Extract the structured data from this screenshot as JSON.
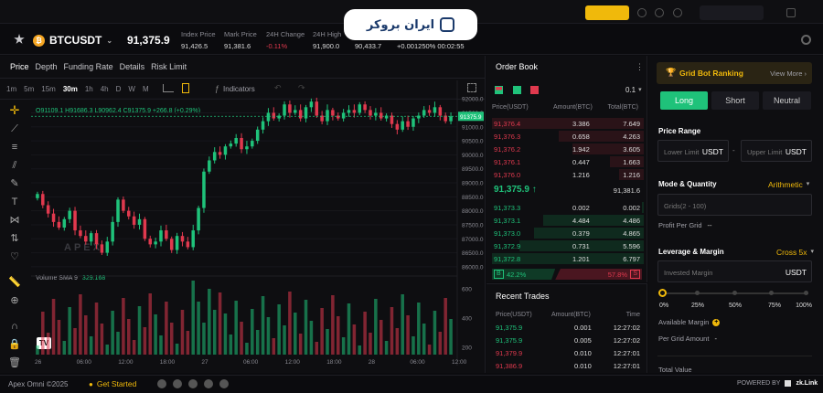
{
  "watermark": {
    "text": "ایران بروکر"
  },
  "ticker": {
    "symbol": "BTCUSDT",
    "last": "91,375.9",
    "stats": [
      {
        "label": "Index Price",
        "value": "91,426.5"
      },
      {
        "label": "Mark Price",
        "value": "91,381.6"
      },
      {
        "label": "24H Change",
        "value": "-0.11%"
      },
      {
        "label": "24H High",
        "value": "91,900.0"
      },
      {
        "label": "",
        "value": "90,433.7"
      },
      {
        "label": "",
        "value": "+0.001250% 00:02:55"
      }
    ]
  },
  "chart_tabs": [
    "Price",
    "Depth",
    "Funding Rate",
    "Details",
    "Risk Limit"
  ],
  "timeframes": [
    "1m",
    "5m",
    "15m",
    "30m",
    "1h",
    "4h",
    "D",
    "W",
    "M"
  ],
  "toolbar": {
    "indicators": "Indicators"
  },
  "ohlc_legend": "O91109.1 H91686.3 L90962.4 C91375.9 +266.8 (+0.29%)",
  "chart_brand": "APEX",
  "volume_legend": {
    "label": "Volume SMA 9",
    "value": "329.168"
  },
  "chart_data": {
    "type": "candlestick",
    "price_axis": [
      "92000.0",
      "91500.0",
      "91000.0",
      "90500.0",
      "90000.0",
      "89500.0",
      "89000.0",
      "88500.0",
      "88000.0",
      "87500.0",
      "87000.0",
      "86500.0",
      "86000.0"
    ],
    "ylim": [
      85800,
      92200
    ],
    "last_price_tag": "91375.9",
    "volume_axis": [
      "600",
      "400",
      "200"
    ],
    "time_axis": [
      "26",
      "06:00",
      "12:00",
      "18:00",
      "27",
      "06:00",
      "12:00",
      "18:00",
      "28",
      "06:00",
      "12:00"
    ],
    "grid": true,
    "closes": [
      88600,
      88200,
      87900,
      87600,
      87400,
      87700,
      88000,
      87300,
      87100,
      86900,
      87200,
      86800,
      86500,
      86900,
      87600,
      88400,
      88000,
      87800,
      87500,
      87700,
      87000,
      86800,
      86900,
      87300,
      87000,
      86600,
      87100,
      86900,
      86700,
      87300,
      88100,
      89400,
      89800,
      90100,
      90000,
      90300,
      90400,
      90600,
      90200,
      90300,
      90500,
      90900,
      91200,
      91500,
      91300,
      91400,
      91800,
      91500,
      91600,
      91300,
      91700,
      91900,
      91400,
      91200,
      91600,
      91400,
      91300,
      91500,
      91600,
      91500,
      91800,
      91600,
      91400,
      91500,
      91300,
      91400,
      91100,
      90900,
      91200,
      91000,
      91300,
      91400,
      91600,
      91500,
      91700,
      91400,
      91200,
      91375
    ]
  },
  "order_book": {
    "title": "Order Book",
    "precision": "0.1",
    "headers": [
      "Price(USDT)",
      "Amount(BTC)",
      "Total(BTC)"
    ],
    "asks": [
      [
        "91,376.4",
        "3.386",
        "7.649"
      ],
      [
        "91,376.3",
        "0.658",
        "4.263"
      ],
      [
        "91,376.2",
        "1.942",
        "3.605"
      ],
      [
        "91,376.1",
        "0.447",
        "1.663"
      ],
      [
        "91,376.0",
        "1.216",
        "1.216"
      ]
    ],
    "mid_price": "91,375.9",
    "mid_mark": "91,381.6",
    "bids": [
      [
        "91,373.3",
        "0.002",
        "0.002"
      ],
      [
        "91,373.1",
        "4.484",
        "4.486"
      ],
      [
        "91,373.0",
        "0.379",
        "4.865"
      ],
      [
        "91,372.9",
        "0.731",
        "5.596"
      ],
      [
        "91,372.8",
        "1.201",
        "6.797"
      ]
    ],
    "buy_label": "B",
    "buy_pct": "42.2%",
    "sell_pct": "57.8%",
    "sell_label": "S",
    "buy_fraction": 0.422
  },
  "recent_trades": {
    "title": "Recent Trades",
    "headers": [
      "Price(USDT)",
      "Amount(BTC)",
      "Time"
    ],
    "rows": [
      {
        "price": "91,375.9",
        "amount": "0.001",
        "time": "12:27:02",
        "side": "buy"
      },
      {
        "price": "91,375.9",
        "amount": "0.005",
        "time": "12:27:02",
        "side": "buy"
      },
      {
        "price": "91,379.9",
        "amount": "0.010",
        "time": "12:27:01",
        "side": "sell"
      },
      {
        "price": "91,386.9",
        "amount": "0.010",
        "time": "12:27:01",
        "side": "sell"
      }
    ]
  },
  "grid_bot": {
    "ranking": "Grid Bot Ranking",
    "view_more": "View More",
    "dirs": [
      "Long",
      "Short",
      "Neutral"
    ],
    "price_range": "Price Range",
    "lower_placeholder": "Lower Limit",
    "upper_placeholder": "Upper Limit",
    "unit": "USDT",
    "range_sep": "-",
    "mode_label": "Mode & Quantity",
    "mode_value": "Arithmetic",
    "grids_placeholder": "Grids(2 - 100)",
    "profit_label": "Profit Per Grid",
    "profit_value": "--",
    "leverage_label": "Leverage & Margin",
    "leverage_value": "Cross 5x",
    "margin_placeholder": "Invested Margin",
    "slider_marks": [
      "0%",
      "25%",
      "50%",
      "75%",
      "100%"
    ],
    "slider_value": 0,
    "available_margin": "Available Margin",
    "per_grid_amount": "Per Grid Amount",
    "per_grid_value": "-",
    "total_value": "Total Value"
  },
  "footer": {
    "copyright": "Apex Omni ©2025",
    "get_started": "Get Started",
    "powered_by": "POWERED BY",
    "powered_brand": "zk.Link"
  },
  "colors": {
    "up": "#1fc27a",
    "down": "#e0394e",
    "accent": "#f0b90b",
    "long": "#1fc27a"
  }
}
